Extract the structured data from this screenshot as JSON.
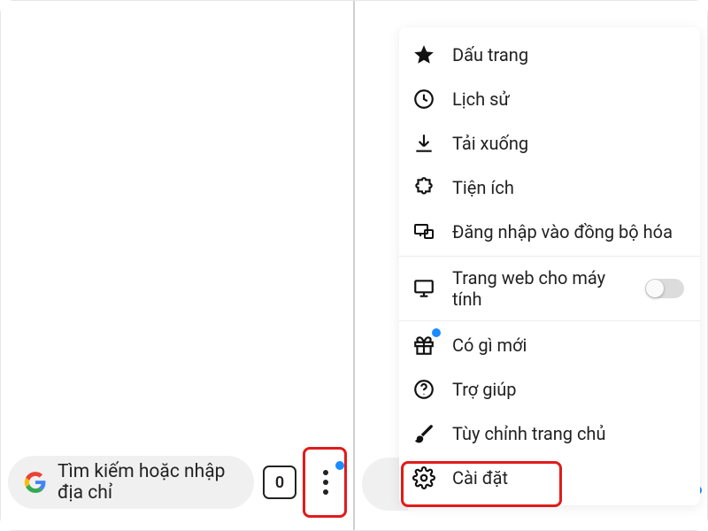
{
  "omnibox": {
    "placeholder": "Tìm kiếm hoặc nhập địa chỉ",
    "tab_count": "0"
  },
  "menu": {
    "bookmarks": "Dấu trang",
    "history": "Lịch sử",
    "downloads": "Tải xuống",
    "extensions": "Tiện ích",
    "sync_login": "Đăng nhập vào đồng bộ hóa",
    "desktop_site": "Trang web cho máy tính",
    "whats_new": "Có gì mới",
    "help": "Trợ giúp",
    "customize_home": "Tùy chỉnh trang chủ",
    "settings": "Cài đặt"
  }
}
